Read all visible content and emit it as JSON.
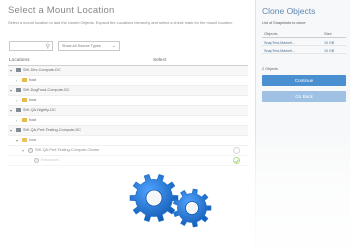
{
  "window": {
    "title": "Select a Mount Location",
    "description": "Select a mount location to add the cloned Objects. Expand the Locations hierarchy and select a check mark for the mount location."
  },
  "filters": {
    "search_placeholder": "",
    "source_type_selected": "Show All Source Types"
  },
  "table": {
    "columns": [
      "Locations",
      "Select"
    ],
    "rows": [
      {
        "label": "SHI-Dev-Compute-DC",
        "type": "dc",
        "indent": 0,
        "toggle": "▾",
        "check": "none"
      },
      {
        "label": "host",
        "type": "folder",
        "indent": 1,
        "toggle": "›",
        "check": "none"
      },
      {
        "label": "SHI-DogFood-Compute-DC",
        "type": "dc",
        "indent": 0,
        "toggle": "▾",
        "check": "none"
      },
      {
        "label": "host",
        "type": "folder",
        "indent": 1,
        "toggle": "›",
        "check": "none"
      },
      {
        "label": "SHI-QA-Nightly-DC",
        "type": "dc",
        "indent": 0,
        "toggle": "▾",
        "check": "none"
      },
      {
        "label": "host",
        "type": "folder",
        "indent": 1,
        "toggle": "›",
        "check": "none"
      },
      {
        "label": "SHI-QA-Perf-Testing-Compute-DC",
        "type": "dc",
        "indent": 0,
        "toggle": "▾",
        "check": "none"
      },
      {
        "label": "host",
        "type": "folder",
        "indent": 1,
        "toggle": "▾",
        "check": "none"
      },
      {
        "label": "SHI-QA-Perf-Testing-Compute-Cluster",
        "type": "cluster",
        "indent": 2,
        "toggle": "▾",
        "check": "circle"
      },
      {
        "label": "Resources",
        "type": "cluster",
        "indent": 3,
        "toggle": "",
        "check": "ok"
      }
    ]
  },
  "clone": {
    "title": "Clone Objects",
    "subtitle": "List of Snapshots to clone",
    "columns": [
      "Objects",
      "Size"
    ],
    "rows": [
      {
        "name": "SnapTest-Marketi...",
        "size": "10 GB"
      },
      {
        "name": "SnapTest-Marketi...",
        "size": "10 GB"
      }
    ],
    "count": "2 Objects",
    "continue_label": "Continue",
    "go_back_label": "Go Back"
  },
  "colors": {
    "accent": "#4a8fd0",
    "accent_disabled": "#9fc2e4",
    "title_blue": "#5d87b3",
    "gear_blue": "#1f72c9"
  },
  "status": {
    "busy_icon": "gears-icon"
  }
}
